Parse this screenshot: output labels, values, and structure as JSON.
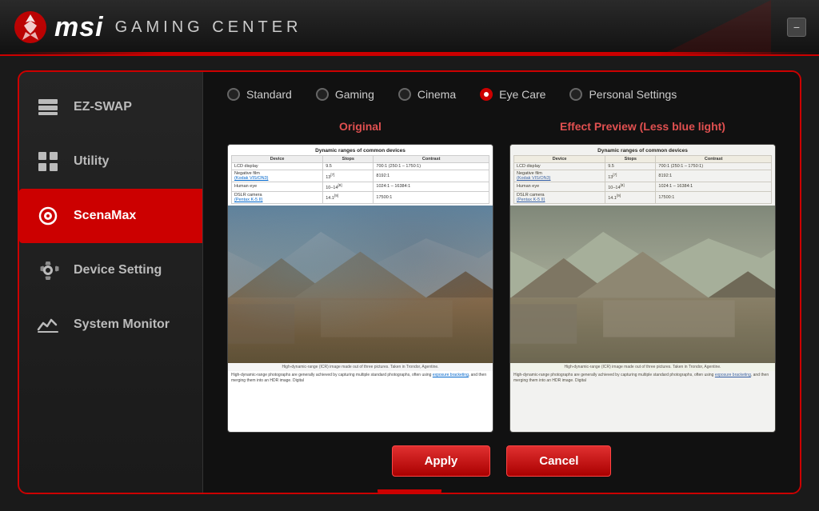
{
  "header": {
    "title_msi": "msi",
    "title_gc": "GAMING CENTER",
    "minimize_label": "−"
  },
  "sidebar": {
    "items": [
      {
        "id": "ez-swap",
        "label": "EZ-SWAP",
        "active": false
      },
      {
        "id": "utility",
        "label": "Utility",
        "active": false
      },
      {
        "id": "scenamax",
        "label": "ScenaMax",
        "active": true
      },
      {
        "id": "device-setting",
        "label": "Device Setting",
        "active": false
      },
      {
        "id": "system-monitor",
        "label": "System Monitor",
        "active": false
      }
    ]
  },
  "content": {
    "radio_options": [
      {
        "id": "standard",
        "label": "Standard",
        "selected": false
      },
      {
        "id": "gaming",
        "label": "Gaming",
        "selected": false
      },
      {
        "id": "cinema",
        "label": "Cinema",
        "selected": false
      },
      {
        "id": "eye-care",
        "label": "Eye Care",
        "selected": true
      },
      {
        "id": "personal",
        "label": "Personal Settings",
        "selected": false
      }
    ],
    "preview_original_title": "Original",
    "preview_effect_title": "Effect Preview (Less blue light)",
    "doc_table_title": "Dynamic ranges of common devices",
    "doc_table_headers": [
      "Device",
      "Stops",
      "Contrast"
    ],
    "doc_table_rows": [
      [
        "LCD display",
        "9.5",
        "700:1 (250:1 – 1750:1)"
      ],
      [
        "Negative film (Kodak VIS/ON3)",
        "13[7]",
        "8192:1"
      ],
      [
        "Human eye",
        "10–14[8]",
        "1024:1 – 16384:1"
      ],
      [
        "DSLR camera (Pentax K-5 II)",
        "14.1[9]",
        "17500:1"
      ]
    ],
    "doc_text": "High-dynamic-range photographs are generally achieved by capturing multiple standard photographs, often using exposure bracketing, and then merging them into an HDR image. Digital",
    "doc_caption": "High-dynamic-range (ICR) image made out of three pictures. Taken in Trondor, Agentine.",
    "buttons": {
      "apply": "Apply",
      "cancel": "Cancel"
    }
  }
}
